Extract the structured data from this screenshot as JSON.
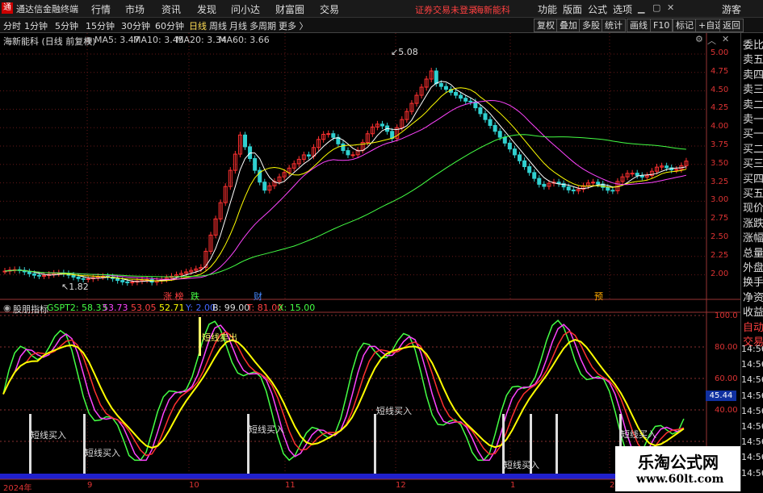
{
  "topbar": {
    "app_title": "通达信金融终端",
    "menus": [
      "行情",
      "市场",
      "资讯",
      "发现",
      "问小达",
      "财富圈",
      "交易"
    ],
    "notice_left": "证券交易未登录",
    "notice_right": "海新能科",
    "right_menus": [
      "功能",
      "版面",
      "公式",
      "选项"
    ],
    "guest": "游客"
  },
  "toolbar": {
    "periods": [
      "分时",
      "1分钟",
      "5分钟",
      "15分钟",
      "30分钟",
      "60分钟",
      "日线",
      "周线",
      "月线",
      "多周期",
      "更多 〉"
    ],
    "active_period": "日线",
    "buttons": [
      "复权",
      "叠加",
      "多股",
      "统计",
      "画线",
      "F10",
      "标记",
      "+自选",
      "返回"
    ]
  },
  "main_chart": {
    "stock_label": "海新能科 (日线 前复权)",
    "ma": [
      {
        "label": "MA5: 3.47",
        "color": "#ffffff"
      },
      {
        "label": "MA10: 3.45",
        "color": "#ffff00"
      },
      {
        "label": "MA20: 3.34",
        "color": "#ff44ff"
      },
      {
        "label": "MA60: 3.66",
        "color": "#44ff44"
      }
    ],
    "high_label": "5.08",
    "low_label": "1.82",
    "price_ticks": [
      "5.00",
      "4.75",
      "4.50",
      "4.25",
      "4.00",
      "3.75",
      "3.50",
      "3.25",
      "3.00",
      "2.75",
      "2.50",
      "2.25",
      "2.00"
    ],
    "events": [
      {
        "text": "涨 榜",
        "color": "#ff4040"
      },
      {
        "text": "跌",
        "color": "#44ff44"
      },
      {
        "text": "财",
        "color": "#4488ff"
      },
      {
        "text": "预",
        "color": "#ffaa00"
      }
    ]
  },
  "indicator": {
    "name": "股朋指标",
    "values": [
      {
        "label": "GSPT2: 58.33",
        "color": "#44ff44"
      },
      {
        "label": "53.73",
        "color": "#ff44ff"
      },
      {
        "label": "53.05",
        "color": "#ff4040"
      },
      {
        "label": "52.71",
        "color": "#ffff00"
      },
      {
        "label": "Y: 2.00",
        "color": "#4466ff"
      },
      {
        "label": "B: 99.00",
        "color": "#dddddd"
      },
      {
        "label": "T: 81.00",
        "color": "#ff4040"
      },
      {
        "label": "X: 15.00",
        "color": "#44ff44"
      }
    ],
    "ticks": [
      "100.0",
      "80.00",
      "60.00",
      "40.00"
    ],
    "current": "45.44",
    "signals": [
      "短线买入",
      "短线买入",
      "短线卖出",
      "短线买入",
      "短线买入",
      "短线买入",
      "短线买入"
    ]
  },
  "date_axis": [
    "2024年",
    "9",
    "10",
    "11",
    "12",
    "1",
    "2"
  ],
  "right_panel": {
    "labels": [
      "委比",
      "卖五",
      "卖四",
      "卖三",
      "卖二",
      "卖一",
      "买一",
      "买二",
      "买三",
      "买四",
      "买五",
      "现价",
      "涨跌",
      "涨幅",
      "总量",
      "外盘",
      "换手",
      "净资",
      "收益",
      "自动",
      "交易"
    ],
    "times": [
      "14:56",
      "14:56",
      "14:56",
      "14:56",
      "14:56",
      "14:56",
      "14:56",
      "14:56",
      "14:56"
    ]
  },
  "watermark": {
    "line1": "乐淘公式网",
    "line2": "www.60lt.com"
  }
}
